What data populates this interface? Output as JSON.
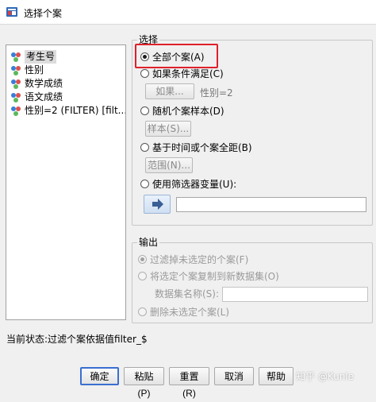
{
  "window": {
    "title": "选择个案"
  },
  "variables": [
    {
      "label": "考生号",
      "icon": "nominal-variable-icon"
    },
    {
      "label": "性别",
      "icon": "nominal-variable-icon"
    },
    {
      "label": "数学成绩",
      "icon": "nominal-variable-icon"
    },
    {
      "label": "语文成绩",
      "icon": "nominal-variable-icon"
    },
    {
      "label": "性别=2 (FILTER) [filt...",
      "icon": "nominal-variable-icon"
    }
  ],
  "select_group": {
    "title": "选择",
    "all_cases": "全部个案(A)",
    "if_condition": "如果条件满足(C)",
    "if_button": "如果...",
    "condition_text": "性别=2",
    "random_sample": "随机个案样本(D)",
    "sample_button": "样本(S)...",
    "time_range": "基于时间或个案全距(B)",
    "range_button": "范围(N)...",
    "use_filter": "使用筛选器变量(U):",
    "filter_value": ""
  },
  "output_group": {
    "title": "输出",
    "filter_out": "过滤掉未选定的个案(F)",
    "copy_to_new": "将选定个案复制到新数据集(O)",
    "dataset_name_label": "数据集名称(S):",
    "dataset_name_value": "",
    "delete_unselected": "删除未选定个案(L)"
  },
  "status": "当前状态:过滤个案依据值filter_$",
  "buttons": {
    "ok": "确定",
    "paste": "粘贴(P)",
    "reset": "重置(R)",
    "cancel": "取消",
    "help": "帮助"
  },
  "watermark": "知乎 @Kunle",
  "colors": {
    "highlight": "#e0202a",
    "default_button_border": "#3a6fd0"
  }
}
